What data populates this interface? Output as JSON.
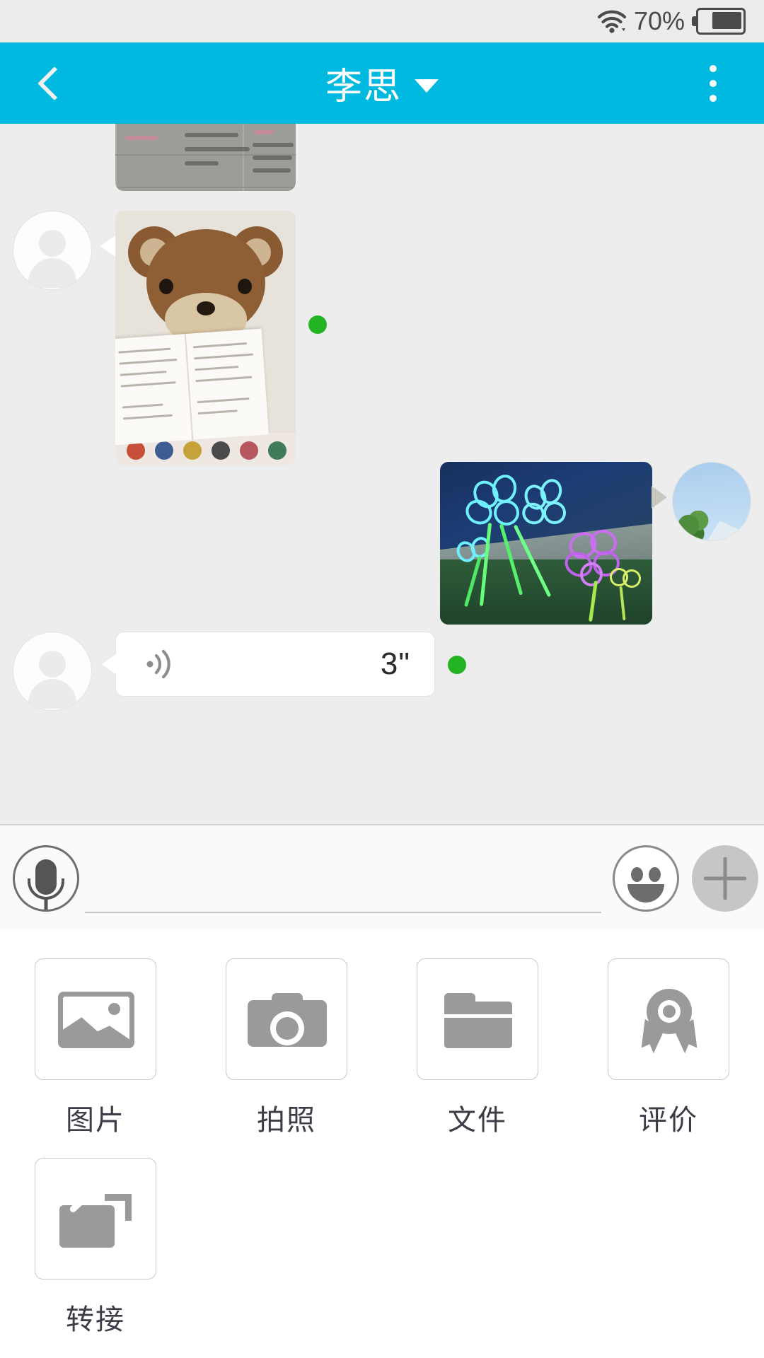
{
  "status_bar": {
    "wifi_icon": "wifi-icon",
    "battery_percent": "70%",
    "battery_icon": "battery-icon"
  },
  "header": {
    "back_icon": "chevron-left-icon",
    "title": "李思",
    "dropdown_icon": "caret-down-icon",
    "more_icon": "more-vertical-icon",
    "background_color": "#00b9e1"
  },
  "chat": {
    "messages": [
      {
        "id": "msg-notes",
        "direction": "incoming",
        "type": "image",
        "description": "handwritten-notes-photo",
        "partially_scrolled": true
      },
      {
        "id": "msg-bear",
        "direction": "incoming",
        "type": "image",
        "description": "teddy-bear-with-open-book-photo",
        "avatar": "default-person-avatar",
        "unread": true
      },
      {
        "id": "msg-lightpainting",
        "direction": "outgoing",
        "type": "image",
        "description": "light-painting-neon-flowers-photo",
        "avatar": "sky-and-tree-photo-avatar"
      },
      {
        "id": "msg-voice",
        "direction": "incoming",
        "type": "voice",
        "duration": "3\"",
        "sound_icon": "sound-wave-icon",
        "avatar": "default-person-avatar",
        "unread": true
      }
    ],
    "unread_dot_color": "#22b422",
    "background_color": "#ededed"
  },
  "toolbar": {
    "mic_icon": "microphone-icon",
    "input_value": "",
    "input_placeholder": "",
    "emoji_icon": "smiley-icon",
    "plus_icon": "plus-icon",
    "plus_active": true
  },
  "attachments": {
    "items": [
      {
        "icon": "picture-icon",
        "label": "图片"
      },
      {
        "icon": "camera-icon",
        "label": "拍照"
      },
      {
        "icon": "folder-icon",
        "label": "文件"
      },
      {
        "icon": "award-icon",
        "label": "评价"
      },
      {
        "icon": "transfer-icon",
        "label": "转接"
      }
    ]
  }
}
